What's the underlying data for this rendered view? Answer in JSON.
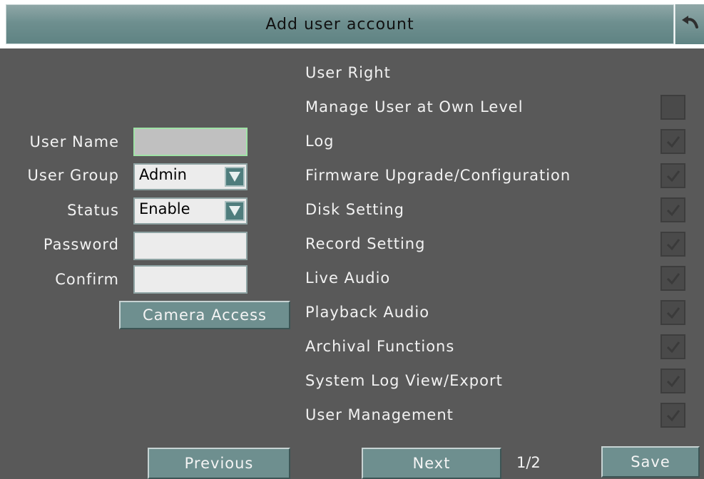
{
  "window": {
    "title": "Add user account"
  },
  "form": {
    "user_name_label": "User Name",
    "user_name_value": "",
    "user_group_label": "User Group",
    "user_group_value": "Admin",
    "status_label": "Status",
    "status_value": "Enable",
    "password_label": "Password",
    "password_value": "",
    "confirm_label": "Confirm",
    "confirm_value": "",
    "camera_access_label": "Camera Access"
  },
  "rights": {
    "header": "User Right",
    "items": [
      {
        "label": "Manage User at Own Level",
        "checked": false
      },
      {
        "label": "Log",
        "checked": true
      },
      {
        "label": "Firmware Upgrade/Configuration",
        "checked": true
      },
      {
        "label": "Disk Setting",
        "checked": true
      },
      {
        "label": "Record Setting",
        "checked": true
      },
      {
        "label": "Live Audio",
        "checked": true
      },
      {
        "label": "Playback Audio",
        "checked": true
      },
      {
        "label": "Archival Functions",
        "checked": true
      },
      {
        "label": "System Log View/Export",
        "checked": true
      },
      {
        "label": "User Management",
        "checked": true
      }
    ]
  },
  "footer": {
    "previous_label": "Previous",
    "next_label": "Next",
    "page_indicator": "1/2",
    "save_label": "Save"
  },
  "icons": {
    "back": "back-arrow-icon",
    "dropdown": "chevron-down-icon",
    "check": "checkmark-icon"
  }
}
